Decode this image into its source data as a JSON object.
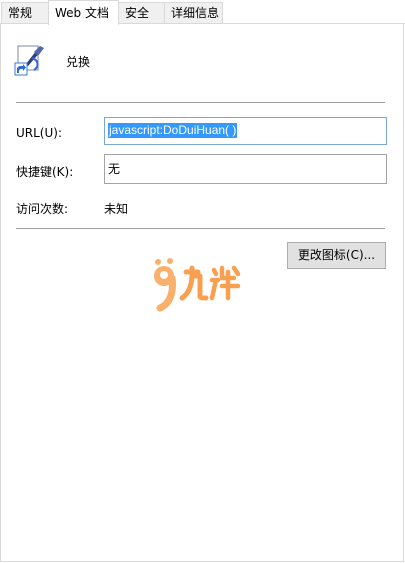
{
  "tabs": [
    {
      "label": "常规",
      "active": false
    },
    {
      "label": "Web 文档",
      "active": true
    },
    {
      "label": "安全",
      "active": false
    },
    {
      "label": "详细信息",
      "active": false
    }
  ],
  "app": {
    "name": "兑换",
    "icon": "shortcut-app-icon"
  },
  "fields": {
    "url_label": "URL(U):",
    "url_value": "javascript:DoDuiHuan( )",
    "hotkey_label": "快捷键(K):",
    "hotkey_value": "无",
    "visits_label": "访问次数:",
    "visits_value": "未知"
  },
  "buttons": {
    "change_icon": "更改图标(C)..."
  },
  "watermark": {
    "text": "九游",
    "color": "#f7a04a"
  },
  "colors": {
    "selection": "#3399ff",
    "button_bg": "#e1e1e1"
  }
}
